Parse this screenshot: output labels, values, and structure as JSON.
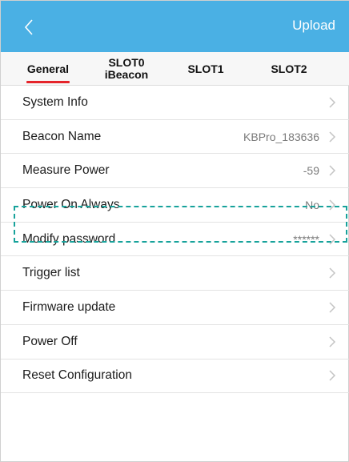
{
  "navbar": {
    "back_icon": "chevron-left-icon",
    "upload_label": "Upload",
    "background_color": "#4ab0e4"
  },
  "tabs": [
    {
      "label": "General",
      "selected": true
    },
    {
      "line1": "SLOT0",
      "line2": "iBeacon"
    },
    {
      "label": "SLOT1"
    },
    {
      "label": "SLOT2"
    }
  ],
  "accent_color": "#e5242b",
  "settings": [
    {
      "label": "System Info",
      "value": ""
    },
    {
      "label": "Beacon Name",
      "value": "KBPro_183636"
    },
    {
      "label": "Measure Power",
      "value": "-59"
    },
    {
      "label": "Power On Always",
      "value": "No"
    },
    {
      "label": "Modify password",
      "value": "******"
    },
    {
      "label": "Trigger list",
      "value": ""
    },
    {
      "label": "Firmware update",
      "value": ""
    },
    {
      "label": "Power Off",
      "value": ""
    },
    {
      "label": "Reset Configuration",
      "value": ""
    }
  ],
  "highlight_color": "#17a29b"
}
